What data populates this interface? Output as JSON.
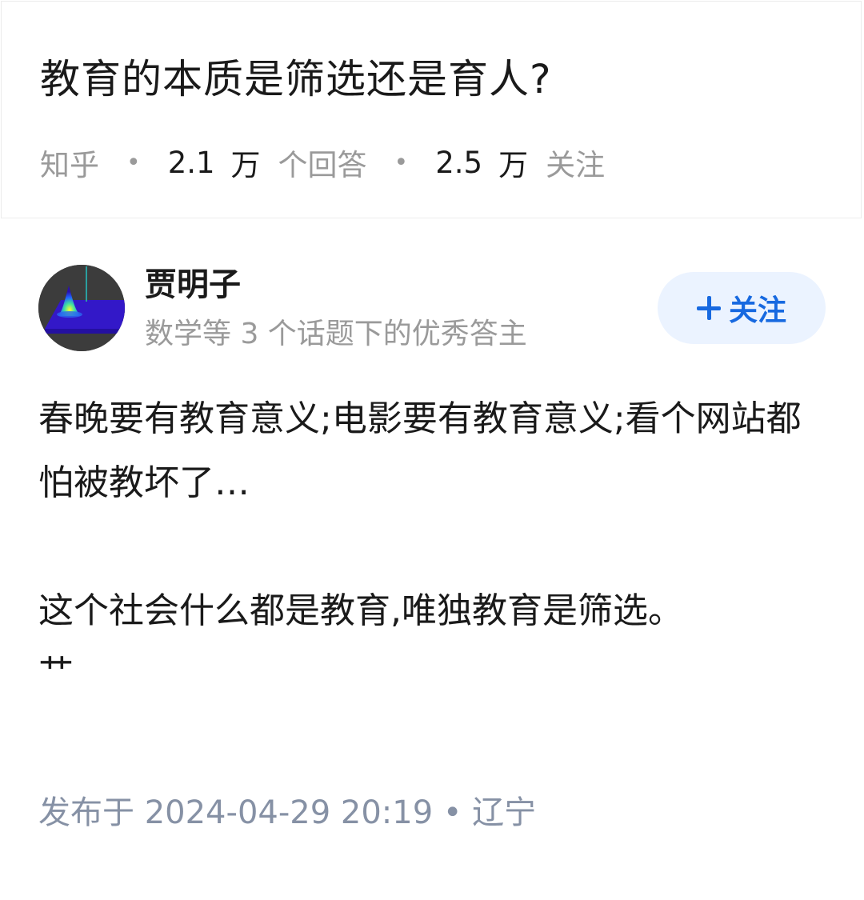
{
  "question": {
    "title": "教育的本质是筛选还是育人?",
    "source": "知乎",
    "answers_count": "2.1",
    "answers_unit": "万",
    "answers_label": "个回答",
    "followers_count": "2.5",
    "followers_unit": "万",
    "followers_label": "关注",
    "separator": "•"
  },
  "author": {
    "name": "贾明子",
    "badge": "数学等 3 个话题下的优秀答主",
    "avatar_icon": "gaussian-plot-avatar-icon"
  },
  "follow_button": {
    "icon": "plus-icon",
    "label": "关注",
    "color": "#1769e0",
    "background": "#ebf3ff"
  },
  "answer": {
    "paragraphs": [
      "春晚要有教育意义;电影要有教育意义;看个网站都怕被教坏了…",
      "这个社会什么都是教育,唯独教育是筛选。"
    ],
    "cut_off_line": "艹",
    "published": "发布于 2024-04-29 20:19 • 辽宁"
  }
}
